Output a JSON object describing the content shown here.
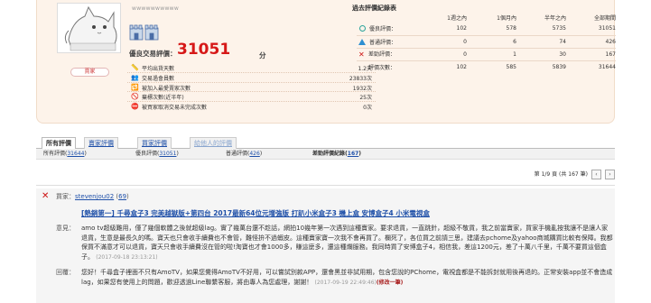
{
  "profile": {
    "username": "wwwwwwwwww",
    "rating_label": "優良交易評價：",
    "rating_score": "31051",
    "rating_unit": "分",
    "badge": "賣家"
  },
  "stats": [
    {
      "icon": "ruler-icon",
      "glyph": "📏",
      "label": "平均出貨天數",
      "value": "1.2天"
    },
    {
      "icon": "people-icon",
      "glyph": "👥",
      "label": "交易過會員數",
      "value": "23833次"
    },
    {
      "icon": "repeat-buyer-icon",
      "glyph": "🔁",
      "label": "被加入最愛賣家次數",
      "value": "1932次"
    },
    {
      "icon": "cancel-icon",
      "glyph": "🚫",
      "label": "棄標次數(近半年)",
      "value": "25次"
    },
    {
      "icon": "block-icon",
      "glyph": "⛔",
      "label": "被買家取消交易未完成次數",
      "value": "0次"
    }
  ],
  "history": {
    "title": "過去評價紀錄表",
    "columns": [
      "1週之內",
      "1個月內",
      "半年之內",
      "全部期間"
    ],
    "rows": [
      {
        "icon": "good",
        "label": "優良評價：",
        "values": [
          "102",
          "578",
          "5735",
          "31051"
        ]
      },
      {
        "icon": "mid",
        "label": "普通評價：",
        "values": [
          "0",
          "6",
          "74",
          "426"
        ]
      },
      {
        "icon": "bad",
        "label": "差勁評價：",
        "values": [
          "0",
          "1",
          "30",
          "167"
        ]
      },
      {
        "icon": "blank",
        "label": "評價次數：",
        "values": [
          "102",
          "585",
          "5839",
          "31644"
        ]
      }
    ]
  },
  "tabs": [
    "所有評價",
    "賣家評價",
    "買家評價",
    "給他人的評價"
  ],
  "summary": {
    "all_label": "所有評價",
    "all_count": "31644",
    "good_label": "優良評價",
    "good_count": "31051",
    "mid_label": "普通評價",
    "mid_count": "426",
    "bad_label": "差勁評價紀錄",
    "bad_count": "167"
  },
  "pager": {
    "prev": "‹",
    "text": "第 1/9 頁 (共 167 筆)",
    "next": "›"
  },
  "review": {
    "buyer_label": "買家：",
    "buyer_name": "stevenjou02",
    "buyer_score": "69",
    "item_title": "[熱銷第一] 千尋盒子3 完美越獄版+第四台 2017最新64位元增強版 打趴小米盒子3 機上盒 安博盒子4 小米電視盒",
    "opinion_label": "意見：",
    "opinion_text": "amo tv超級難用，僅了幾個軟體之後就超級lag。實了幾萬台還不趁話，網拍10幾年第一次遇到這種賣家。要求退貨，一直跳針，超級不敬貨，我之前當賣家，買家手機亂按我讓不是讓人家退貨，生意是最長久的嗎。寶天也只會收手續費也不會管，難怪拚不過蝦皮。這種賣家寶一次我不會再買了。欄死了，各位買之前請三思，建議去pchome及yahoo商城購買比較有保障。我都保買不滿意才可以退貨，寶天只會收手續費沒在管的啦!淘寶也才會1000多，賺這麼多，還這種爛服務。我同時買了安博盒子4，相信我，差這1200元，差了十萬八千里",
    "opinion_end": "，千萬不要買這個盒子。",
    "opinion_time": "(2017-09-18 23:13:21)",
    "reply_label": "回覆：",
    "reply_text": "您好！千尋盒子裡面不只有AmoTV，如果您覺得AmoTV不好用，可以嘗試別款APP，還會黑並非試用期，包含您說的PChome，電視盒都是不能拆封就用後再退的。正常安裝app並不會造成lag，如果您有使用上的問題，歡迎透過Line聯繫客服，將由專人為您處理，謝謝！",
    "reply_time": "(2017-09-19 22:49:46)",
    "reply_edit": "(修改一筆)"
  }
}
